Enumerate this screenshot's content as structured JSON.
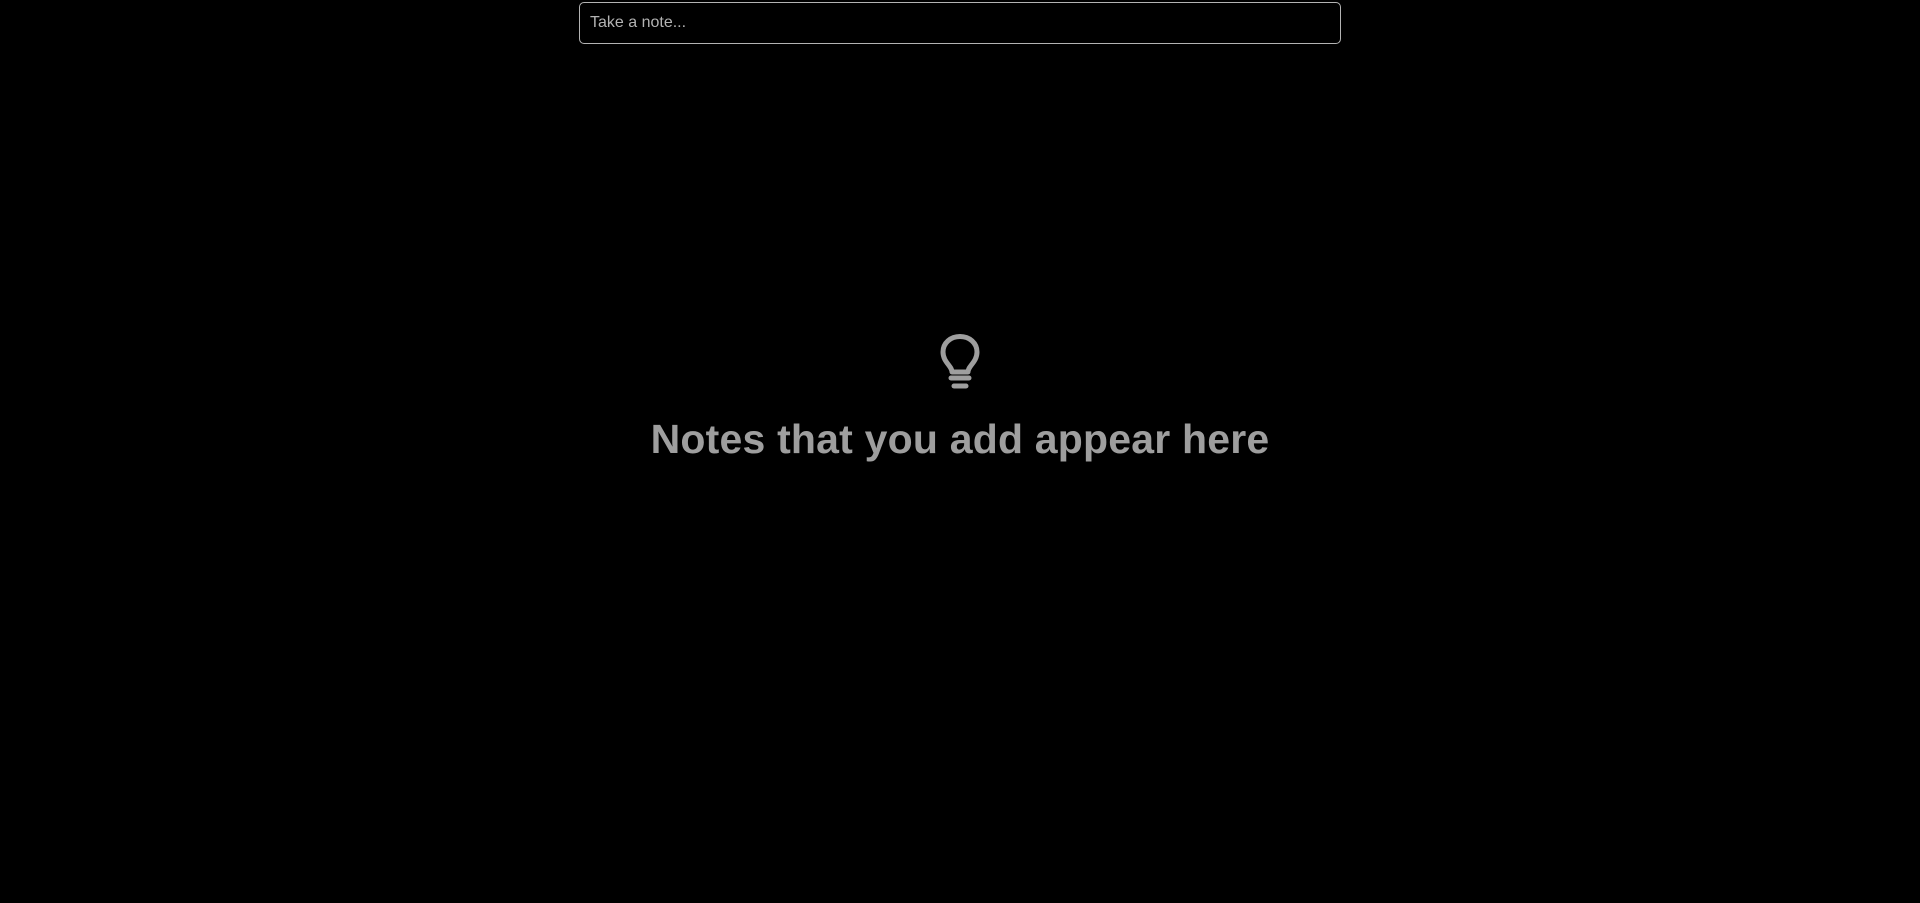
{
  "note_input": {
    "placeholder": "Take a note...",
    "value": ""
  },
  "empty_state": {
    "icon": "lightbulb-icon",
    "message": "Notes that you add appear here"
  },
  "colors": {
    "background": "#000000",
    "input_border": "#b3b3b3",
    "muted_text": "#9e9e9e"
  }
}
